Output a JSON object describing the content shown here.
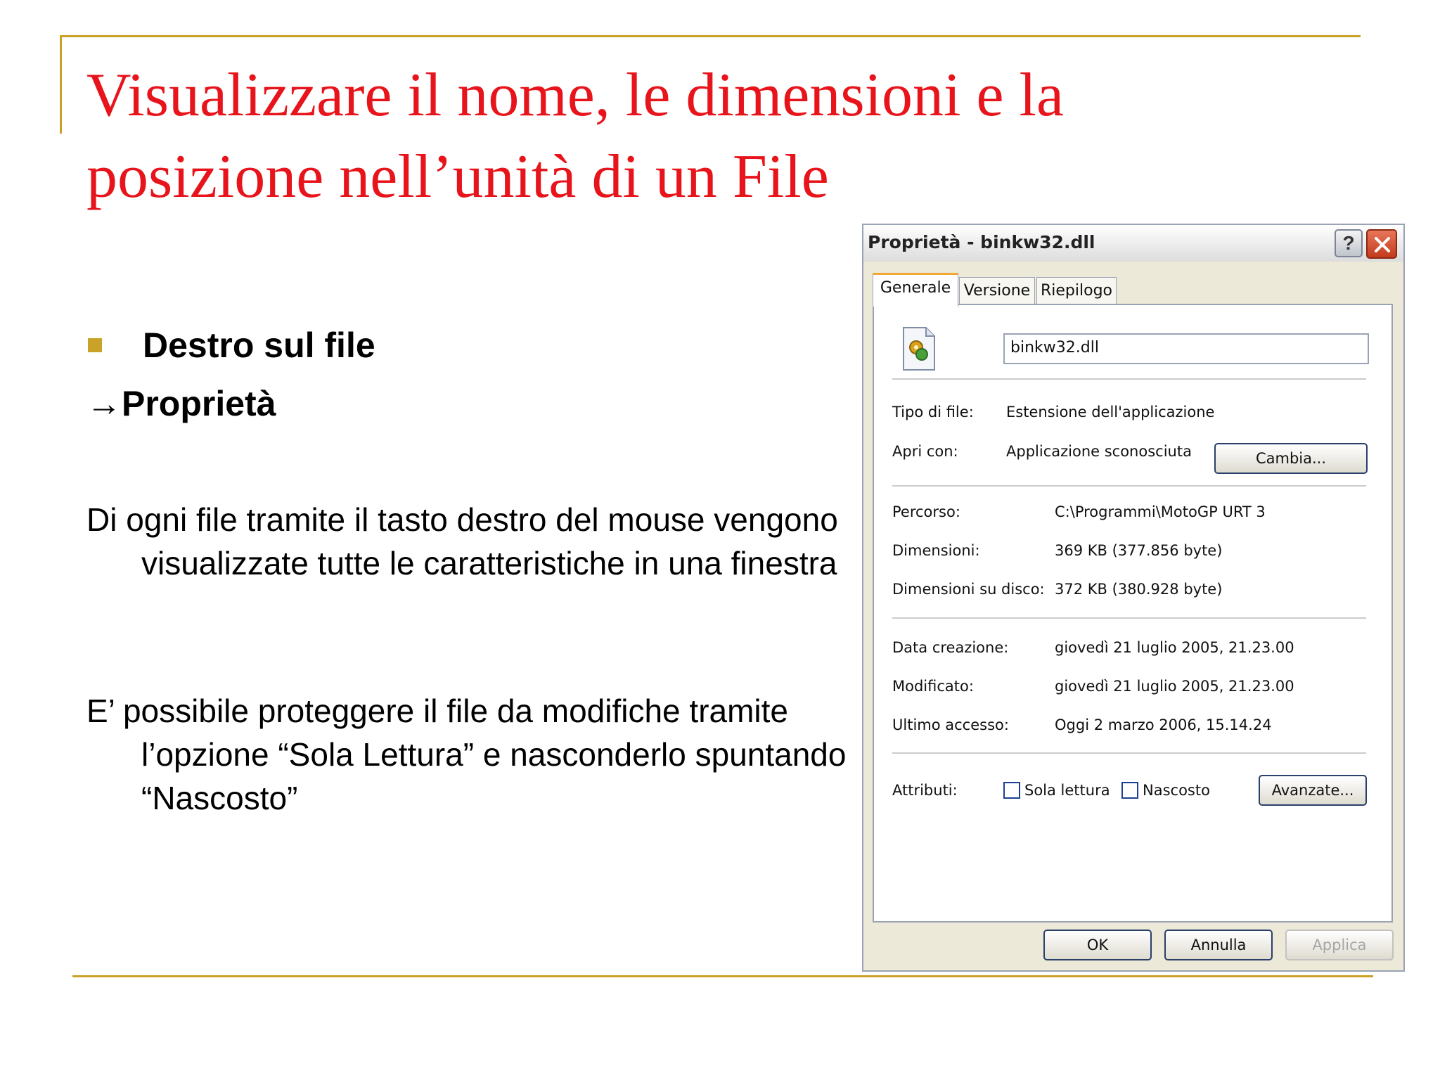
{
  "slide": {
    "title": "Visualizzare il nome, le dimensioni e la posizione nell’unità di un File",
    "bullet": "Destro sul file",
    "arrow_line": "→Proprietà",
    "paragraph1": "Di ogni file tramite il tasto destro del mouse vengono visualizzate tutte le caratteristiche in una finestra",
    "paragraph2": "E’ possibile proteggere il file da modifiche tramite l’opzione “Sola Lettura” e nasconderlo spuntando “Nascosto”"
  },
  "dialog": {
    "title": "Proprietà - binkw32.dll",
    "help_label": "?",
    "tabs": [
      "Generale",
      "Versione",
      "Riepilogo"
    ],
    "filename": "binkw32.dll",
    "file_type_label": "Tipo di file:",
    "file_type_value": "Estensione dell'applicazione",
    "open_with_label": "Apri con:",
    "open_with_value": "Applicazione sconosciuta",
    "change_button": "Cambia...",
    "path_label": "Percorso:",
    "path_value": "C:\\Programmi\\MotoGP URT 3",
    "size_label": "Dimensioni:",
    "size_value": "369 KB (377.856 byte)",
    "size_on_disk_label": "Dimensioni su disco:",
    "size_on_disk_value": "372 KB (380.928 byte)",
    "created_label": "Data creazione:",
    "created_value": "giovedì 21 luglio 2005, 21.23.00",
    "modified_label": "Modificato:",
    "modified_value": "giovedì 21 luglio 2005, 21.23.00",
    "accessed_label": "Ultimo accesso:",
    "accessed_value": "Oggi 2 marzo 2006, 15.14.24",
    "attributes_label": "Attributi:",
    "readonly_label": "Sola lettura",
    "hidden_label": "Nascosto",
    "advanced_button": "Avanzate...",
    "ok_button": "OK",
    "cancel_button": "Annulla",
    "apply_button": "Applica"
  },
  "colors": {
    "title": "#e8141c",
    "accent_rule": "#c9a227",
    "dialog_bg": "#ece9d8"
  }
}
